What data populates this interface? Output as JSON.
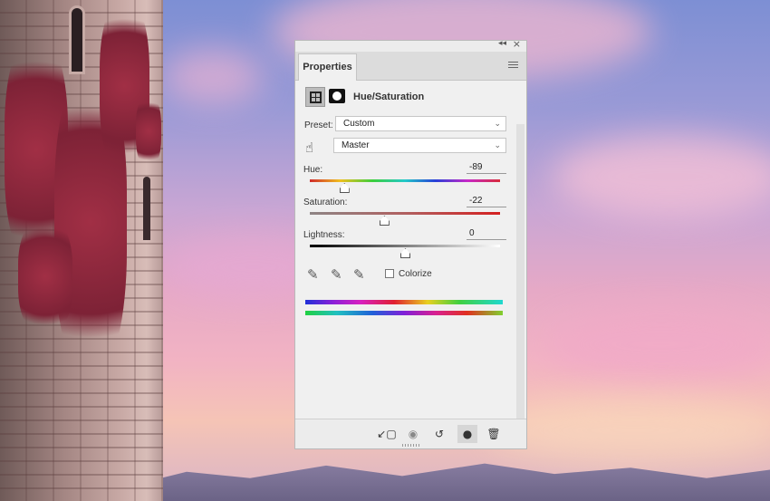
{
  "panel": {
    "tab_label": "Properties",
    "title": "Hue/Saturation",
    "collapse_icon": "double-chevron-left-icon",
    "close_icon": "close-icon",
    "menu_icon": "panel-menu-icon",
    "preset": {
      "label": "Preset:",
      "value": "Custom"
    },
    "channel": {
      "value": "Master",
      "icon": "targeted-adjustment-hand-icon"
    },
    "sliders": [
      {
        "label": "Hue:",
        "value": "-89",
        "fraction": 0.18
      },
      {
        "label": "Saturation:",
        "value": "-22",
        "fraction": 0.39
      },
      {
        "label": "Lightness:",
        "value": "0",
        "fraction": 0.5
      }
    ],
    "eyedroppers": [
      "eyedropper-icon",
      "eyedropper-add-icon",
      "eyedropper-subtract-icon"
    ],
    "colorize": {
      "label": "Colorize",
      "checked": false
    },
    "footer": {
      "buttons": [
        "clip-to-layer-icon",
        "view-previous-state-icon",
        "reset-icon",
        "toggle-visibility-icon",
        "delete-icon"
      ]
    }
  }
}
